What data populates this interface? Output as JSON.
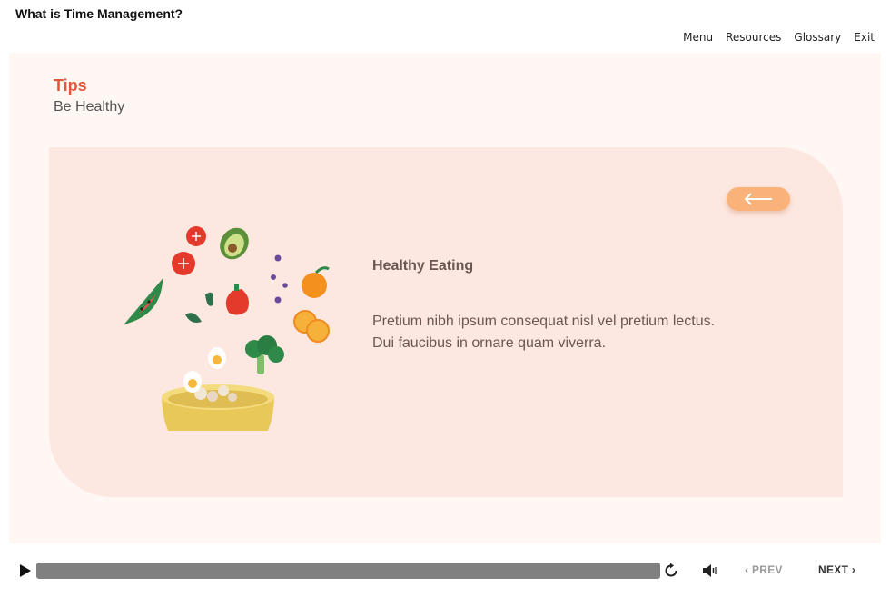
{
  "course": {
    "title": "What is Time Management?"
  },
  "nav": {
    "menu": "Menu",
    "resources": "Resources",
    "glossary": "Glossary",
    "exit": "Exit"
  },
  "slide": {
    "heading": "Tips",
    "subheading": "Be Healthy",
    "card": {
      "title": "Healthy Eating",
      "body": "Pretium nibh ipsum consequat nisl vel pretium lectus. Dui faucibus in ornare quam viverra.",
      "back_icon": "arrow-left-icon",
      "illustration": "healthy-food-bowl-illustration"
    }
  },
  "player": {
    "play_icon": "play-icon",
    "replay_icon": "replay-icon",
    "volume_icon": "volume-icon",
    "prev_label": "PREV",
    "next_label": "NEXT",
    "prev_glyph": "‹",
    "next_glyph": "›"
  },
  "colors": {
    "accent": "#e2563a",
    "stage_bg": "#fef7f4",
    "card_bg": "#fde8e1",
    "button_orange": "#f8b27a",
    "seekbar": "#808080"
  }
}
